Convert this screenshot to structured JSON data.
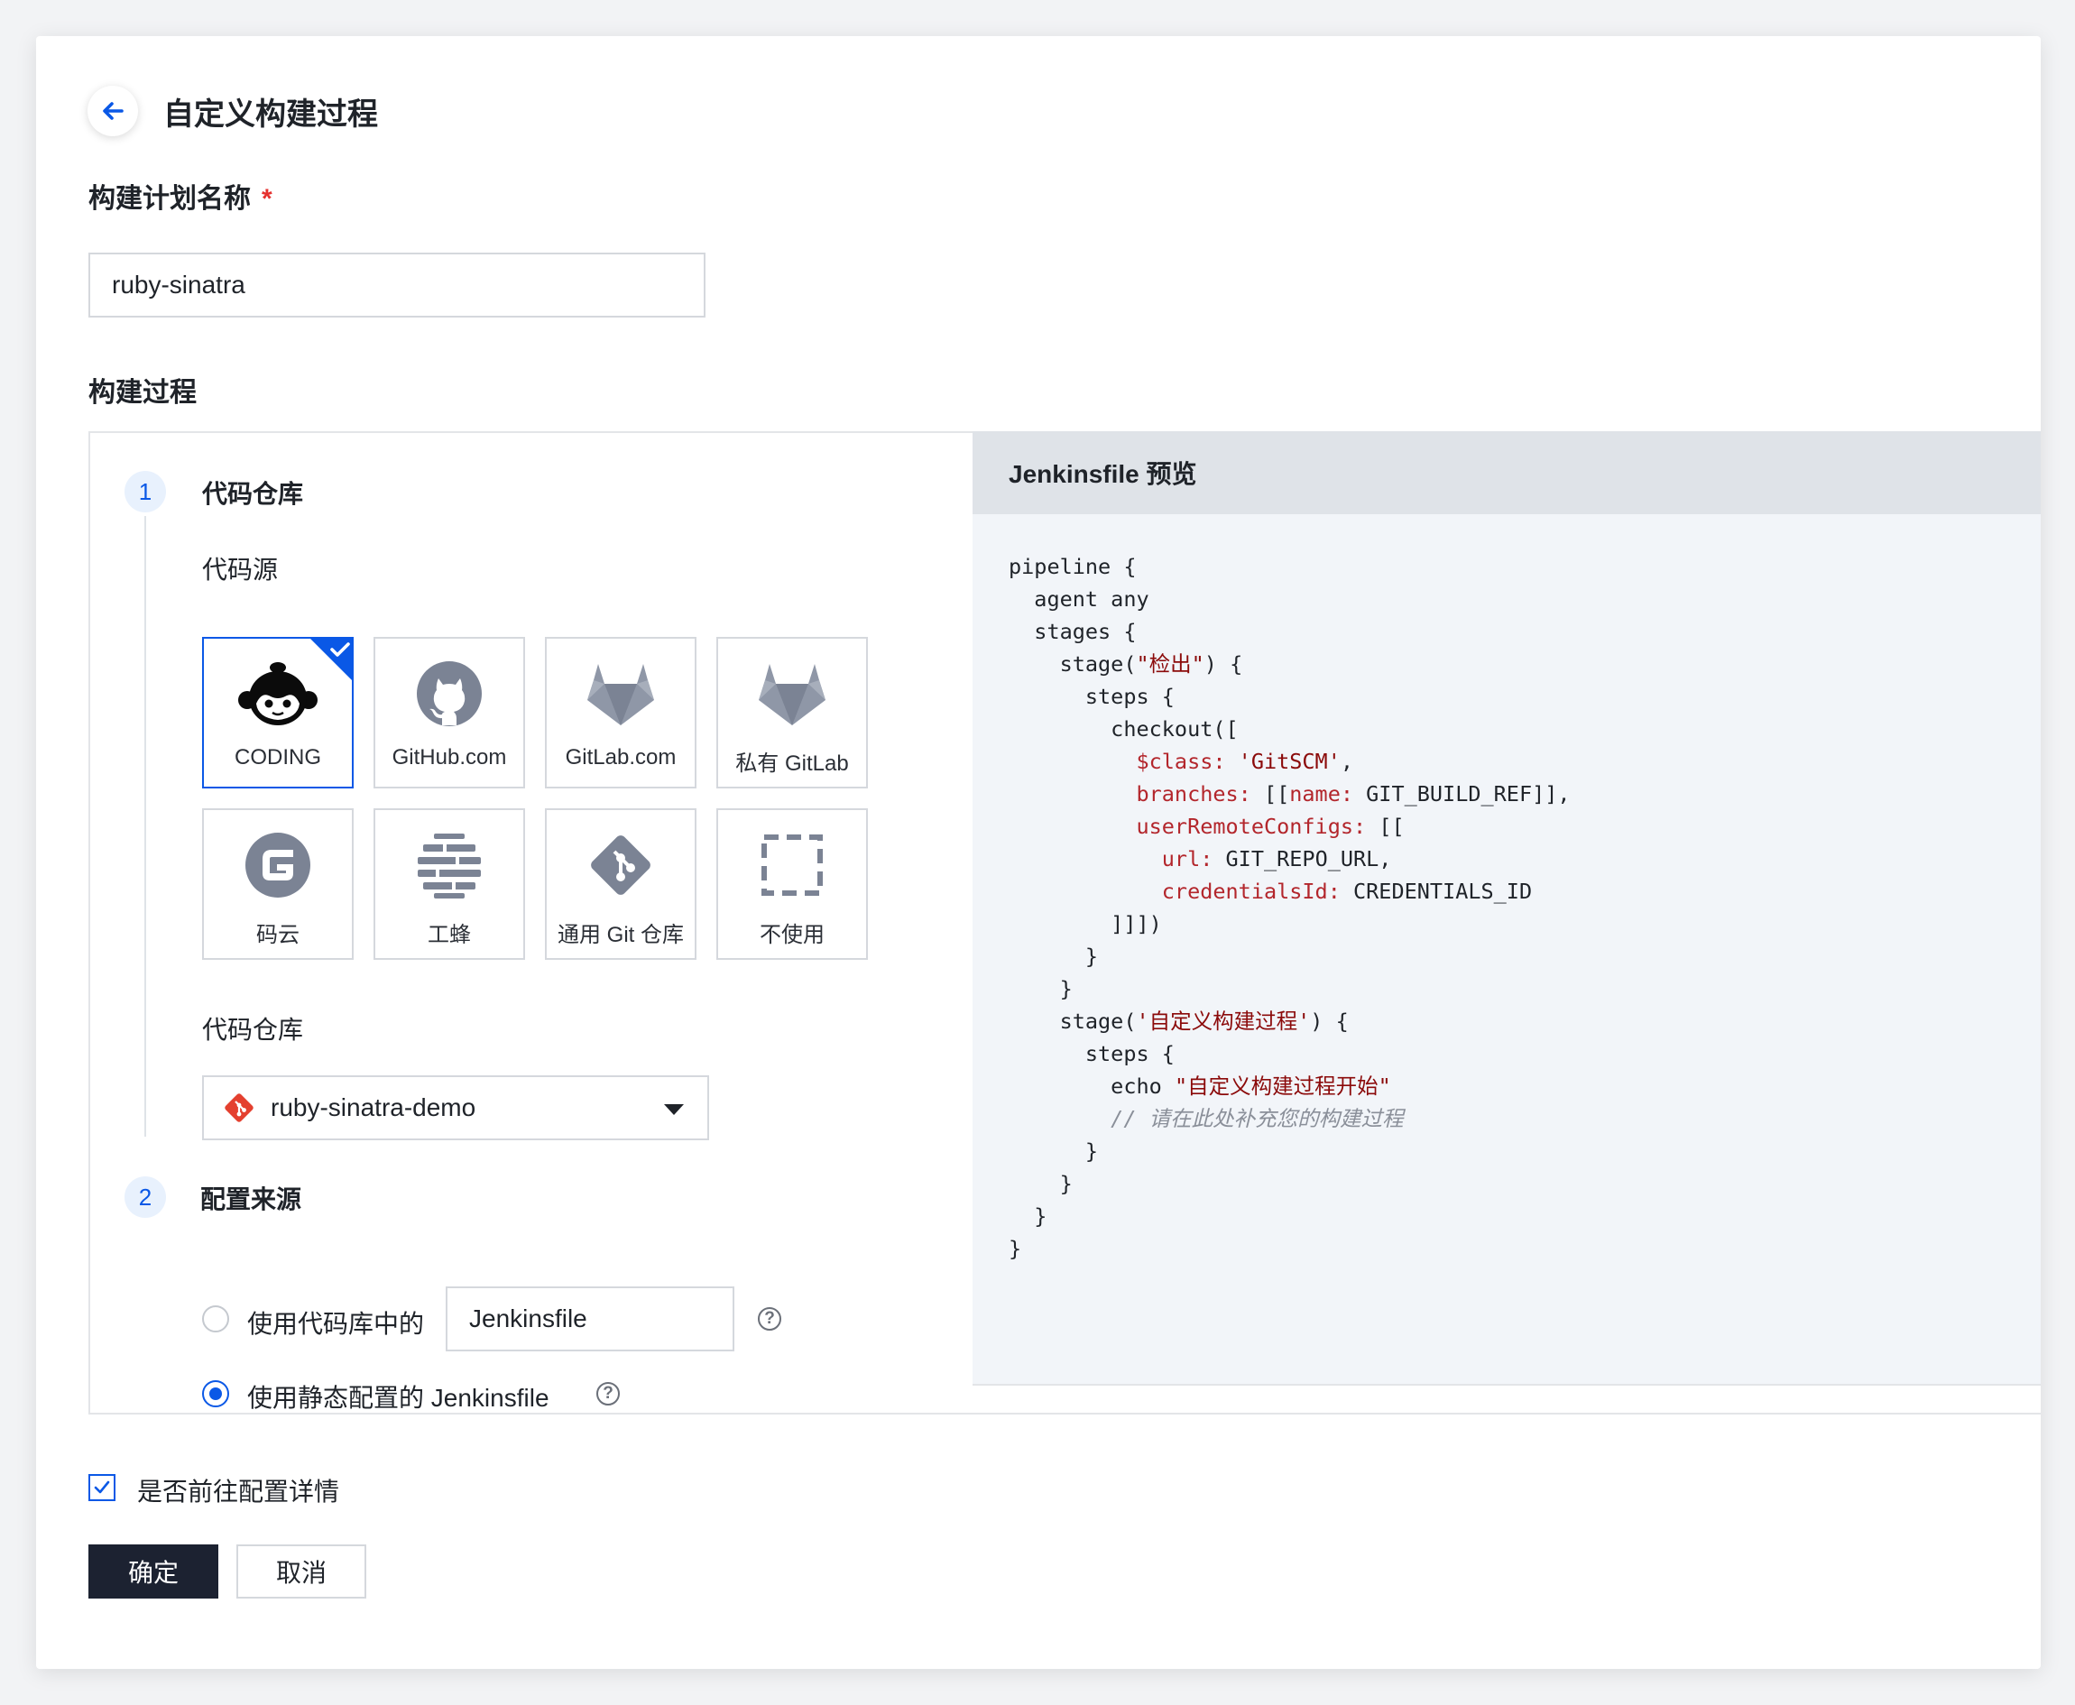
{
  "page": {
    "title": "自定义构建过程"
  },
  "plan_name": {
    "label": "构建计划名称",
    "required_mark": "*",
    "value": "ruby-sinatra"
  },
  "process": {
    "label": "构建过程",
    "step1": {
      "number": "1",
      "title": "代码仓库",
      "source_label": "代码源",
      "sources": [
        {
          "name": "CODING",
          "icon": "coding-monkey-icon",
          "selected": true
        },
        {
          "name": "GitHub.com",
          "icon": "github-icon",
          "selected": false
        },
        {
          "name": "GitLab.com",
          "icon": "gitlab-icon",
          "selected": false
        },
        {
          "name": "私有 GitLab",
          "icon": "private-gitlab-icon",
          "selected": false
        },
        {
          "name": "码云",
          "icon": "gitee-icon",
          "selected": false
        },
        {
          "name": "工蜂",
          "icon": "gongfeng-icon",
          "selected": false
        },
        {
          "name": "通用 Git 仓库",
          "icon": "git-icon",
          "selected": false
        },
        {
          "name": "不使用",
          "icon": "dashed-square-icon",
          "selected": false
        }
      ],
      "repo_label": "代码仓库",
      "repo_value": "ruby-sinatra-demo"
    },
    "step2": {
      "number": "2",
      "title": "配置来源",
      "option_repo_label": "使用代码库中的",
      "option_repo_input": "Jenkinsfile",
      "option_static_label": "使用静态配置的 Jenkinsfile",
      "selected": "static"
    }
  },
  "preview": {
    "title": "Jenkinsfile 预览",
    "lines": {
      "l1": "pipeline {",
      "l2": "  agent any",
      "l3": "  stages {",
      "l4a": "    stage(",
      "l4s": "\"检出\"",
      "l4b": ") {",
      "l5": "      steps {",
      "l6": "        checkout([",
      "l7k": "          $class: ",
      "l7s": "'GitSCM'",
      "l7e": ",",
      "l8k": "          branches: ",
      "l8a": "[[",
      "l8k2": "name:",
      "l8e": " GIT_BUILD_REF]],",
      "l9k": "          userRemoteConfigs: ",
      "l9e": "[[",
      "l10k": "            url: ",
      "l10e": "GIT_REPO_URL,",
      "l11k": "            credentialsId: ",
      "l11e": "CREDENTIALS_ID",
      "l12": "        ]]])",
      "l13": "      }",
      "l14": "    }",
      "l15a": "    stage(",
      "l15s": "'自定义构建过程'",
      "l15b": ") {",
      "l16": "      steps {",
      "l17a": "        echo ",
      "l17s": "\"自定义构建过程开始\"",
      "l18": "        // 请在此处补充您的构建过程",
      "l19": "      }",
      "l20": "    }",
      "l21": "  }",
      "l22": "}"
    }
  },
  "footer": {
    "goto_detail_label": "是否前往配置详情",
    "goto_detail_checked": true,
    "confirm_label": "确定",
    "cancel_label": "取消"
  },
  "colors": {
    "accent": "#0a58e6",
    "primary_button": "#1c2231",
    "required": "#e5312f"
  }
}
